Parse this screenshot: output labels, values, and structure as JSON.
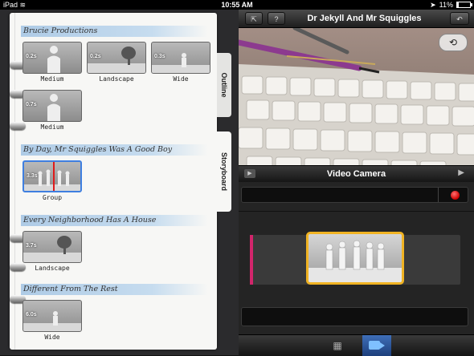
{
  "status_bar": {
    "carrier": "iPad",
    "time": "10:55 AM",
    "battery": "11%",
    "battery_level": 0.11
  },
  "header": {
    "title": "Dr Jekyll And Mr Squiggles"
  },
  "video_bar": {
    "title": "Video Camera"
  },
  "tabs": [
    {
      "label": "Outline"
    },
    {
      "label": "Storyboard"
    }
  ],
  "scenes": [
    {
      "title": "Brucie Productions",
      "clips": [
        {
          "duration": "0.2s",
          "label": "Medium",
          "icon": "person-silhouette"
        },
        {
          "duration": "0.2s",
          "label": "Landscape",
          "icon": "tree-silhouette"
        },
        {
          "duration": "0.3s",
          "label": "Wide",
          "icon": "small-person-silhouette"
        },
        {
          "duration": "0.7s",
          "label": "Medium",
          "icon": "person-silhouette"
        }
      ]
    },
    {
      "title": "By Day, Mr Squiggles Was A Good Boy",
      "clips": [
        {
          "duration": "3.3s",
          "label": "Group",
          "icon": "group-silhouette",
          "selected": true
        }
      ]
    },
    {
      "title": "Every Neighborhood Has A House",
      "clips": [
        {
          "duration": "3.7s",
          "label": "Landscape",
          "icon": "tree-silhouette"
        }
      ]
    },
    {
      "title": "Different From The Rest",
      "clips": [
        {
          "duration": "6.0s",
          "label": "Wide",
          "icon": "small-person-silhouette"
        }
      ]
    }
  ],
  "colors": {
    "accent_selected_clip": "#f0b323",
    "record": "#cc0000",
    "storyboard_selection": "#3f7fe0",
    "playhead": "#e01b1b"
  }
}
